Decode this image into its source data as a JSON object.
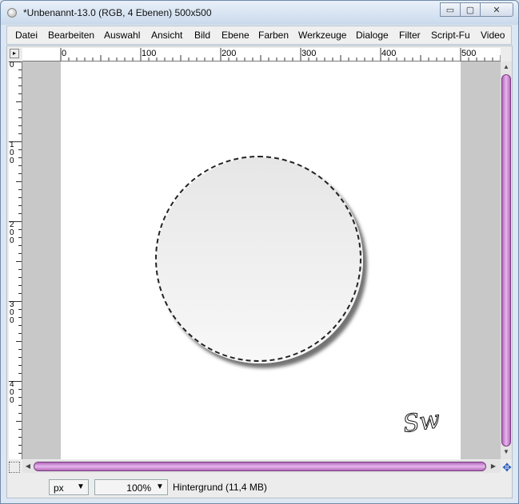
{
  "window": {
    "title": "*Unbenannt-13.0 (RGB, 4 Ebenen) 500x500",
    "buttons": {
      "minimize": "▭",
      "maximize": "▢",
      "close": "✕"
    }
  },
  "menubar": {
    "items": [
      "Datei",
      "Bearbeiten",
      "Auswahl",
      "Ansicht",
      "Bild",
      "Ebene",
      "Farben",
      "Werkzeuge",
      "Dialoge",
      "Filter",
      "Script-Fu",
      "Video"
    ]
  },
  "rulers": {
    "horizontal_labels": [
      "0",
      "100",
      "200",
      "300",
      "400",
      "500"
    ],
    "vertical_labels": [
      "0",
      "100",
      "200",
      "300",
      "400"
    ]
  },
  "canvas": {
    "signature_text": "Sw"
  },
  "statusbar": {
    "unit": "px",
    "zoom": "100%",
    "message": "Hintergrund (11,4 MB)"
  },
  "icons": {
    "app": "gimp-app-icon",
    "navigate": "navigate-icon",
    "quick_mask": "quick-mask-icon",
    "dropdown": "chevron-down-icon"
  },
  "colors": {
    "scrollbar_thumb": "#c98fd1",
    "canvas_padding": "#c8c8c8",
    "image_background": "#ffffff"
  }
}
